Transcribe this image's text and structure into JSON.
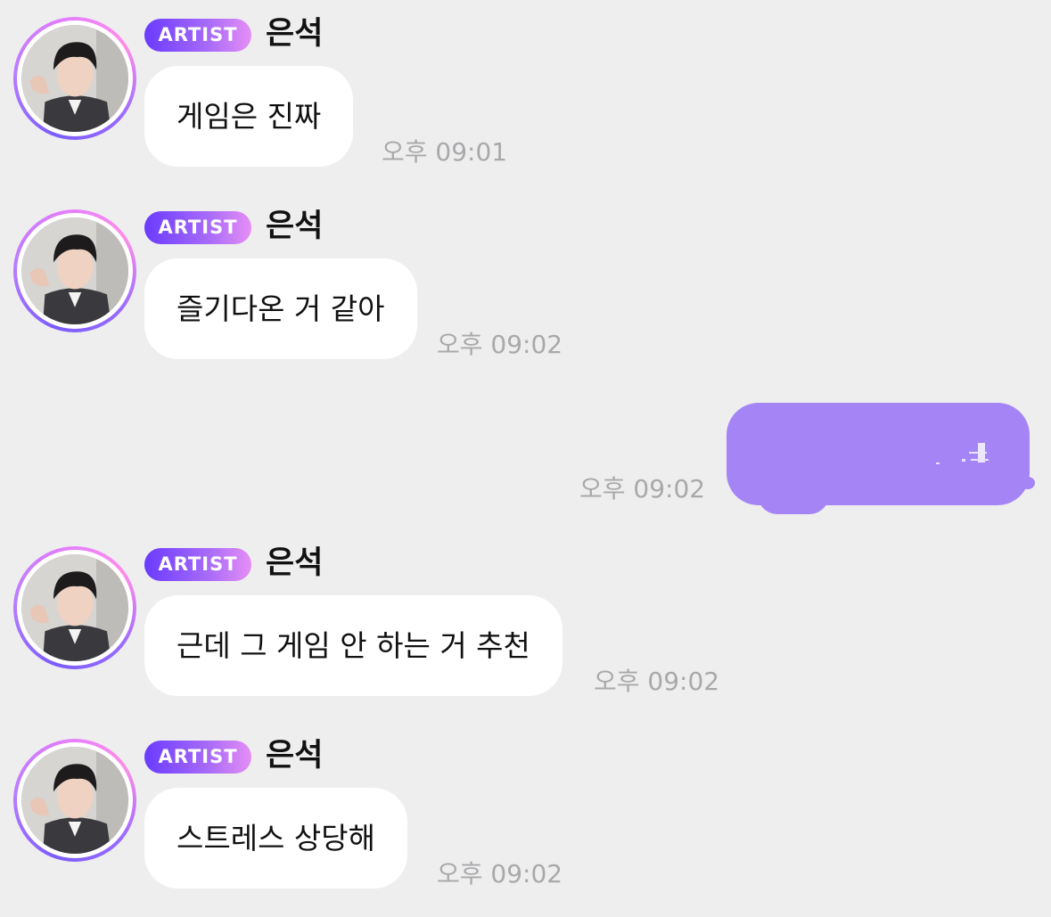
{
  "messages": [
    {
      "badge": "ARTIST",
      "name": "은석",
      "text": "게임은 진짜",
      "time": "오후 09:01"
    },
    {
      "badge": "ARTIST",
      "name": "은석",
      "text": "즐기다온 거 같아",
      "time": "오후 09:02"
    },
    {
      "badge": "ARTIST",
      "name": "은석",
      "text": "근데 그 게임 안 하는 거 추천",
      "time": "오후 09:02"
    },
    {
      "badge": "ARTIST",
      "name": "은석",
      "text": "스트레스 상당해",
      "time": "오후 09:02"
    }
  ],
  "my_message": {
    "time": "오후 09:02",
    "bubble_color": "#a585f6"
  },
  "colors": {
    "background": "#eeeeef",
    "badge_gradient_start": "#6a3bff",
    "badge_gradient_end": "#e58ef5",
    "time_text": "#a9a9ab"
  }
}
